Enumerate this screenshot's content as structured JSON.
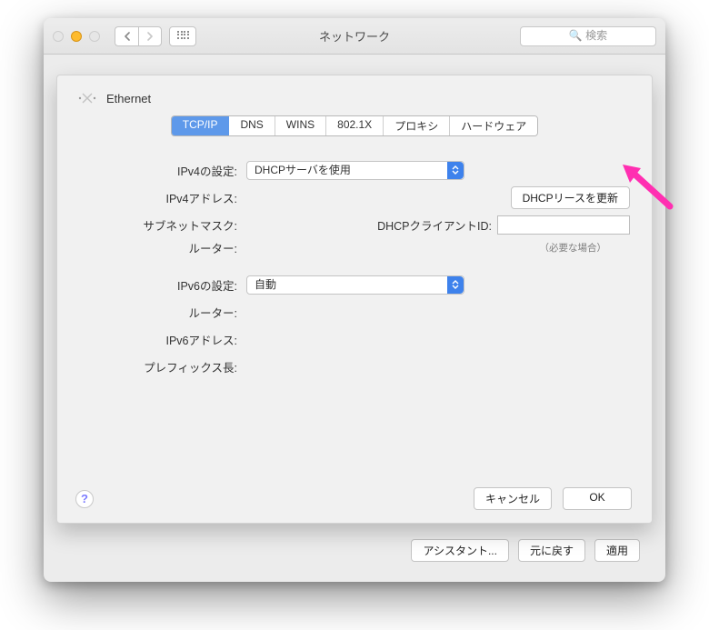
{
  "window": {
    "title": "ネットワーク",
    "search_placeholder": "検索"
  },
  "sheet": {
    "header": "Ethernet",
    "tabs": [
      "TCP/IP",
      "DNS",
      "WINS",
      "802.1X",
      "プロキシ",
      "ハードウェア"
    ],
    "active_tab": "TCP/IP",
    "labels": {
      "ipv4_config": "IPv4の設定:",
      "ipv4_addr": "IPv4アドレス:",
      "subnet": "サブネットマスク:",
      "router4": "ルーター:",
      "ipv6_config": "IPv6の設定:",
      "router6": "ルーター:",
      "ipv6_addr": "IPv6アドレス:",
      "prefix_len": "プレフィックス長:",
      "dhcp_client_id": "DHCPクライアントID:",
      "if_needed": "（必要な場合）"
    },
    "values": {
      "ipv4_config_selected": "DHCPサーバを使用",
      "ipv6_config_selected": "自動"
    },
    "buttons": {
      "renew_lease": "DHCPリースを更新",
      "cancel": "キャンセル",
      "ok": "OK"
    }
  },
  "background_buttons": {
    "assistant": "アシスタント...",
    "revert": "元に戻す",
    "apply": "適用"
  }
}
